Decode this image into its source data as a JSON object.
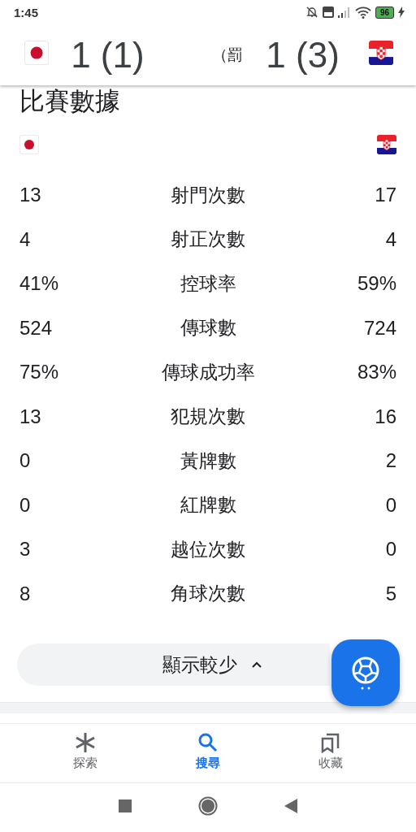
{
  "status_bar": {
    "time": "1:45",
    "battery": "96"
  },
  "header": {
    "home_score": "1 (1)",
    "status": "（罰",
    "away_score": "1 (3)"
  },
  "section_title": "比賽數據",
  "stats": [
    {
      "home": "13",
      "label": "射門次數",
      "away": "17"
    },
    {
      "home": "4",
      "label": "射正次數",
      "away": "4"
    },
    {
      "home": "41%",
      "label": "控球率",
      "away": "59%"
    },
    {
      "home": "524",
      "label": "傳球數",
      "away": "724"
    },
    {
      "home": "75%",
      "label": "傳球成功率",
      "away": "83%"
    },
    {
      "home": "13",
      "label": "犯規次數",
      "away": "16"
    },
    {
      "home": "0",
      "label": "黃牌數",
      "away": "2"
    },
    {
      "home": "0",
      "label": "紅牌數",
      "away": "0"
    },
    {
      "home": "3",
      "label": "越位次數",
      "away": "0"
    },
    {
      "home": "8",
      "label": "角球次數",
      "away": "5"
    }
  ],
  "toggle_button": {
    "label": "顯示較少",
    "expanded": true
  },
  "nav": [
    {
      "kind": "explore",
      "label": "探索",
      "selected": false
    },
    {
      "kind": "search",
      "label": "搜尋",
      "selected": true
    },
    {
      "kind": "saved",
      "label": "收藏",
      "selected": false
    }
  ]
}
